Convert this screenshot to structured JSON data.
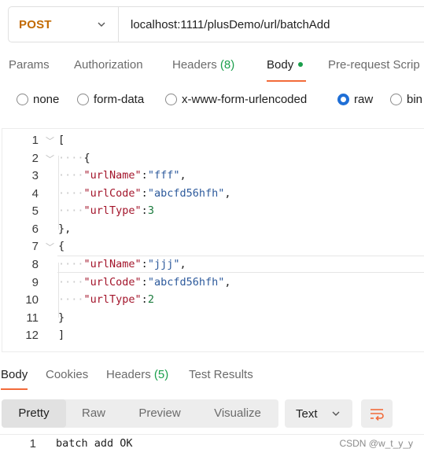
{
  "request": {
    "method": "POST",
    "url": "localhost:1111/plusDemo/url/batchAdd"
  },
  "request_tabs": {
    "params": "Params",
    "authorization": "Authorization",
    "headers_label": "Headers",
    "headers_count": "(8)",
    "body": "Body",
    "prerequest": "Pre-request Scrip"
  },
  "body_types": {
    "none": "none",
    "form_data": "form-data",
    "urlencoded": "x-www-form-urlencoded",
    "raw": "raw",
    "binary": "bin",
    "selected": "raw"
  },
  "editor": {
    "line_numbers": [
      "1",
      "2",
      "3",
      "4",
      "5",
      "6",
      "7",
      "8",
      "9",
      "10",
      "11",
      "12"
    ],
    "items": [
      {
        "urlName": "fff",
        "urlCode": "abcfd56hfh",
        "urlType": "3"
      },
      {
        "urlName": "jjj",
        "urlCode": "abcfd56hfh",
        "urlType": "2"
      }
    ],
    "open_bracket": "[",
    "close_bracket": "]",
    "open_brace": "{",
    "close_brace": "}",
    "close_brace_comma": "},"
  },
  "response_tabs": {
    "body": "Body",
    "cookies": "Cookies",
    "headers_label": "Headers",
    "headers_count": "(5)",
    "test_results": "Test Results"
  },
  "response_view": {
    "pretty": "Pretty",
    "raw": "Raw",
    "preview": "Preview",
    "visualize": "Visualize",
    "format": "Text"
  },
  "response_body": {
    "line_number": "1",
    "text": "batch add OK"
  },
  "watermark": "CSDN @w_t_y_y",
  "colors": {
    "method": "#c26a00",
    "accent": "#f26b3a",
    "radio_selected": "#1f6fd6",
    "json_key": "#a3152b",
    "json_string": "#2d5a9c",
    "json_number": "#1a7a3c"
  }
}
